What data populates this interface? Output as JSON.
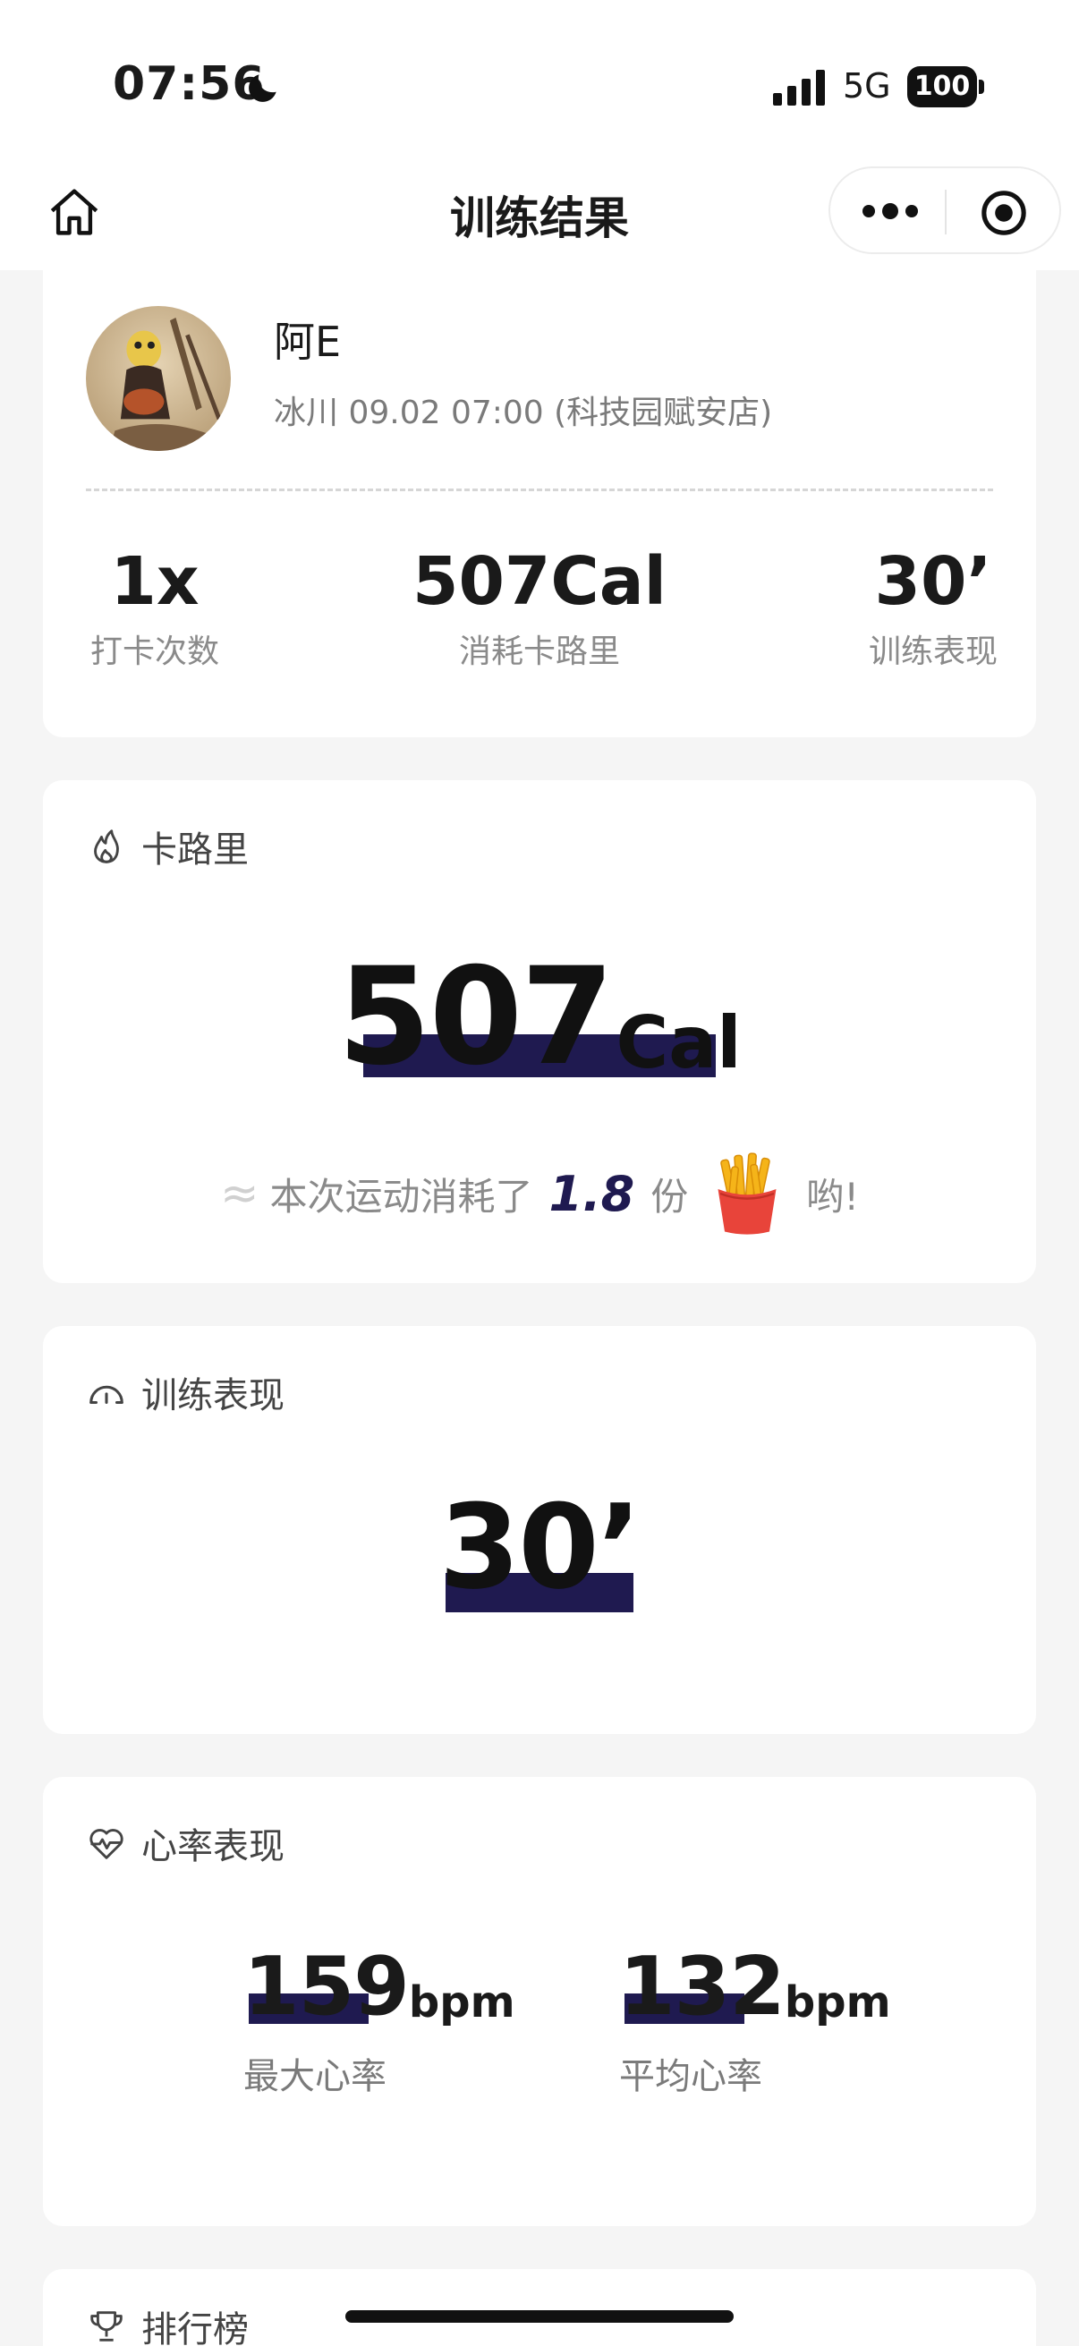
{
  "status_bar": {
    "time": "07:56",
    "network": "5G",
    "battery": "100"
  },
  "nav": {
    "title": "训练结果"
  },
  "profile": {
    "name": "阿E",
    "session": "冰川 09.02 07:00 (科技园赋安店)",
    "stats": [
      {
        "value": "1x",
        "label": "打卡次数"
      },
      {
        "value": "507Cal",
        "label": "消耗卡路里"
      },
      {
        "value": "30’",
        "label": "训练表现"
      }
    ]
  },
  "calories": {
    "title": "卡路里",
    "value": "507",
    "unit": "Cal",
    "note": {
      "approx": "≈",
      "prefix": "本次运动消耗了",
      "factor": "1.8",
      "measure": "份",
      "suffix": "哟!"
    }
  },
  "performance": {
    "title": "训练表现",
    "value": "30’"
  },
  "heart_rate": {
    "title": "心率表现",
    "items": [
      {
        "value": "159",
        "unit": "bpm",
        "label": "最大心率"
      },
      {
        "value": "132",
        "unit": "bpm",
        "label": "平均心率"
      }
    ]
  },
  "ranking": {
    "title": "排行榜"
  },
  "colors": {
    "highlight": "#1f1a50",
    "background": "#f5f5f5",
    "card": "#ffffff",
    "muted_text": "#8a8a8a"
  },
  "icons": [
    "moon-icon",
    "signal-icon",
    "home-icon",
    "more-icon",
    "target-icon",
    "flame-icon",
    "gauge-icon",
    "heart-pulse-icon",
    "fries-icon",
    "trophy-icon"
  ]
}
